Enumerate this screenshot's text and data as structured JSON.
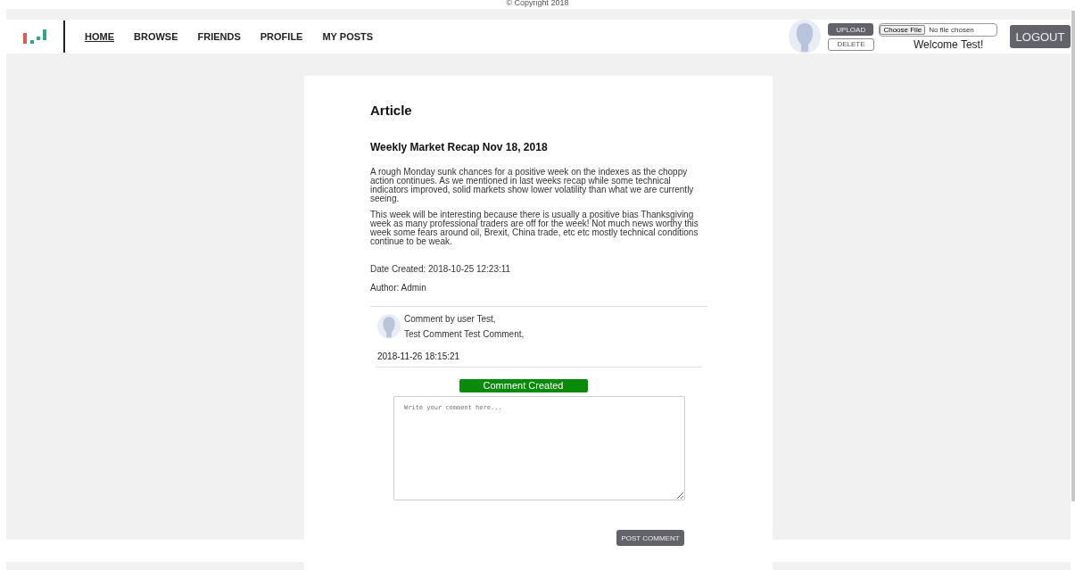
{
  "copyright": "© Copyright 2018",
  "nav": [
    {
      "label": "HOME",
      "selected": true
    },
    {
      "label": "BROWSE",
      "selected": false
    },
    {
      "label": "FRIENDS",
      "selected": false
    },
    {
      "label": "PROFILE",
      "selected": false
    },
    {
      "label": "MY POSTS",
      "selected": false
    }
  ],
  "user_panel": {
    "upload": "UPLOAD",
    "delete": "DELETE",
    "choose_file": "Choose File",
    "file_status": "No file chosen",
    "welcome": "Welcome Test!",
    "logout": "LOGOUT"
  },
  "article": {
    "heading": "Article",
    "title": "Weekly Market Recap Nov 18, 2018",
    "paragraphs": [
      "A rough Monday sunk chances for a positive week on the indexes as the choppy action continues. As we mentioned in last weeks recap while some technical indicators improved, solid markets show lower volatility than what we are currently seeing.",
      "This week will be interesting because there is usually a positive bias Thanksgiving week as many professional traders are off for the week! Not much news worthy this week some fears around oil, Brexit, China trade, etc etc mostly technical conditions continue to be weak."
    ],
    "date_created": "Date Created: 2018-10-25 12:23:11",
    "author": "Author: Admin"
  },
  "comments": [
    {
      "by": "Comment by user Test,",
      "text": "Test Comment Test Comment,",
      "date": "2018-11-26 18:15:21"
    }
  ],
  "status_message": "Comment Created",
  "comment_box": {
    "placeholder": "Write your comment here..."
  },
  "post_button": "POST COMMENT"
}
